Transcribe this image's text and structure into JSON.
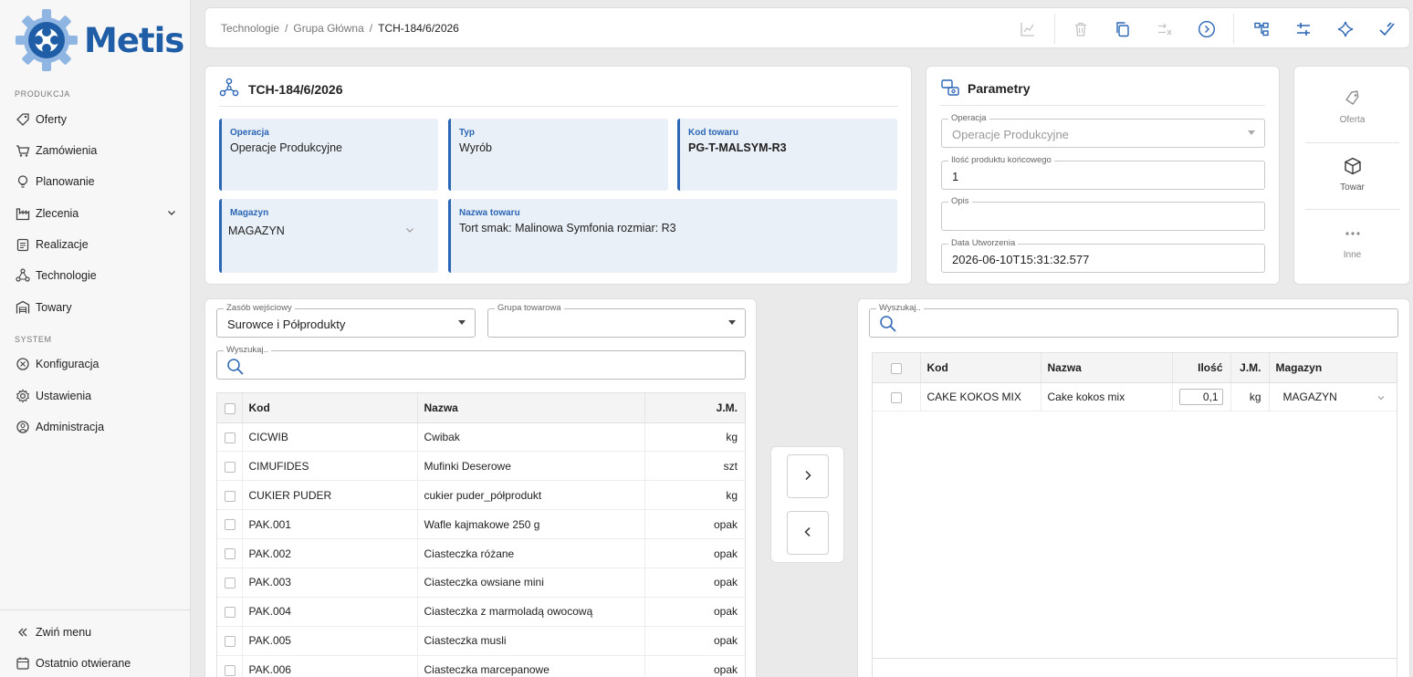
{
  "app": {
    "name": "Metis"
  },
  "sidebar": {
    "section_production": "PRODUKCJA",
    "section_system": "SYSTEM",
    "items": [
      {
        "label": "Oferty",
        "icon": "tag-icon"
      },
      {
        "label": "Zamówienia",
        "icon": "cart-icon"
      },
      {
        "label": "Planowanie",
        "icon": "lightbulb-icon"
      },
      {
        "label": "Zlecenia",
        "icon": "factory-icon"
      },
      {
        "label": "Realizacje",
        "icon": "clipboard-icon"
      },
      {
        "label": "Technologie",
        "icon": "nodes-icon"
      },
      {
        "label": "Towary",
        "icon": "warehouse-icon"
      }
    ],
    "system_items": [
      {
        "label": "Konfiguracja",
        "icon": "sliders-icon"
      },
      {
        "label": "Ustawienia",
        "icon": "gear-icon"
      },
      {
        "label": "Administracja",
        "icon": "shield-icon"
      }
    ],
    "collapse_label": "Zwiń menu",
    "recent_label": "Ostatnio otwierane"
  },
  "breadcrumb": [
    "Technologie",
    "Grupa Główna",
    "TCH-184/6/2026"
  ],
  "header_card": {
    "title": "TCH-184/6/2026",
    "fields": [
      {
        "label": "Operacja",
        "value": "Operacje Produkcyjne"
      },
      {
        "label": "Typ",
        "value": "Wyrób"
      },
      {
        "label": "Kod towaru",
        "value": "PG-T-MALSYM-R3"
      },
      {
        "label": "Magazyn",
        "value": "MAGAZYN"
      },
      {
        "label": "Nazwa towaru",
        "value": "Tort smak: Malinowa Symfonia rozmiar: R3"
      }
    ]
  },
  "params": {
    "title": "Parametry",
    "operacja": {
      "label": "Operacja",
      "value": "Operacje Produkcyjne"
    },
    "ilosc": {
      "label": "Ilość produktu końcowego",
      "value": "1"
    },
    "opis": {
      "label": "Opis",
      "value": ""
    },
    "data": {
      "label": "Data Utworzenia",
      "value": "2026-06-10T15:31:32.577"
    }
  },
  "side_actions": [
    {
      "label": "Oferta",
      "icon": "tag-icon"
    },
    {
      "label": "Towar",
      "icon": "box-icon"
    },
    {
      "label": "Inne",
      "icon": "more-icon"
    }
  ],
  "left_panel": {
    "zasob": {
      "label": "Zasób wejściowy",
      "value": "Surowce i Półprodukty"
    },
    "grupa": {
      "label": "Grupa towarowa",
      "value": ""
    },
    "search_label": "Wyszukaj..",
    "columns": [
      "Kod",
      "Nazwa",
      "J.M."
    ],
    "rows": [
      {
        "kod": "CICWIB",
        "nazwa": "Cwibak",
        "jm": "kg"
      },
      {
        "kod": "CIMUFIDES",
        "nazwa": "Mufinki Deserowe",
        "jm": "szt"
      },
      {
        "kod": "CUKIER PUDER",
        "nazwa": "cukier puder_półprodukt",
        "jm": "kg"
      },
      {
        "kod": "PAK.001",
        "nazwa": "Wafle kajmakowe 250 g",
        "jm": "opak"
      },
      {
        "kod": "PAK.002",
        "nazwa": "Ciasteczka różane",
        "jm": "opak"
      },
      {
        "kod": "PAK.003",
        "nazwa": "Ciasteczka owsiane mini",
        "jm": "opak"
      },
      {
        "kod": "PAK.004",
        "nazwa": "Ciasteczka z marmoladą owocową",
        "jm": "opak"
      },
      {
        "kod": "PAK.005",
        "nazwa": "Ciasteczka musli",
        "jm": "opak"
      },
      {
        "kod": "PAK.006",
        "nazwa": "Ciasteczka marcepanowe",
        "jm": "opak"
      }
    ]
  },
  "right_panel": {
    "search_label": "Wyszukaj..",
    "columns": [
      "Kod",
      "Nazwa",
      "Ilość",
      "J.M.",
      "Magazyn"
    ],
    "rows": [
      {
        "kod": "CAKE KOKOS MIX",
        "nazwa": "Cake kokos mix",
        "ilosc": "0,1",
        "jm": "kg",
        "magazyn": "MAGAZYN"
      }
    ]
  },
  "colors": {
    "accent": "#2a66b5",
    "field_bg": "#eaf0f7"
  }
}
